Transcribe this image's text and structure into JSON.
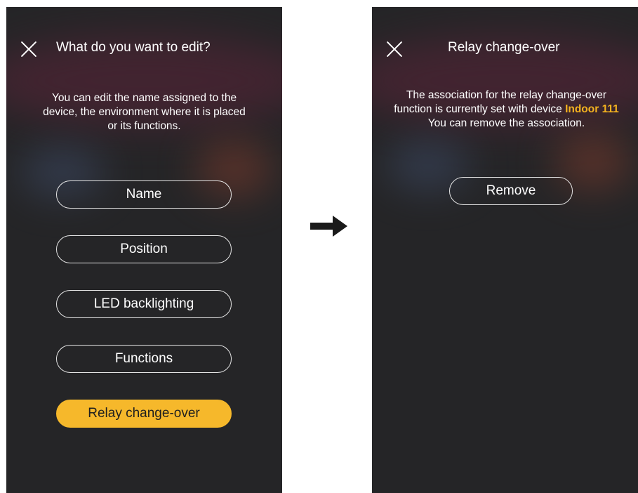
{
  "left_screen": {
    "title": "What do you want to edit?",
    "description_lines": [
      "You can edit the name assigned to the",
      "device, the environment where it is placed",
      "or its functions."
    ],
    "options": [
      {
        "label": "Name",
        "selected": false
      },
      {
        "label": "Position",
        "selected": false
      },
      {
        "label": "LED backlighting",
        "selected": false
      },
      {
        "label": "Functions",
        "selected": false
      },
      {
        "label": "Relay change-over",
        "selected": true
      }
    ]
  },
  "right_screen": {
    "title": "Relay change-over",
    "description": {
      "line1": "The association for the relay change-over",
      "line2_prefix": "function is currently set with device ",
      "device_name": "Indoor 111",
      "line3": "You can remove the association."
    },
    "remove_label": "Remove"
  },
  "icons": {
    "close": "close-icon",
    "arrow": "arrow-right-icon"
  },
  "colors": {
    "background": "#252527",
    "accent": "#f6b82b",
    "highlight_text": "#f4b21f",
    "text": "#ffffff"
  }
}
